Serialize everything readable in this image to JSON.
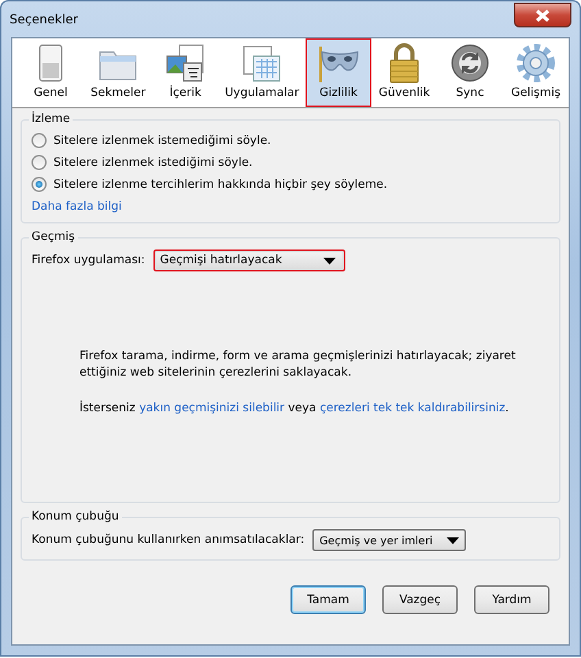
{
  "window": {
    "title": "Seçenekler"
  },
  "tabs": [
    {
      "label": "Genel",
      "selected": false
    },
    {
      "label": "Sekmeler",
      "selected": false
    },
    {
      "label": "İçerik",
      "selected": false
    },
    {
      "label": "Uygulamalar",
      "selected": false
    },
    {
      "label": "Gizlilik",
      "selected": true
    },
    {
      "label": "Güvenlik",
      "selected": false
    },
    {
      "label": "Sync",
      "selected": false
    },
    {
      "label": "Gelişmiş",
      "selected": false
    }
  ],
  "tracking": {
    "title": "İzleme",
    "options": [
      {
        "label": "Sitelere izlenmek istemediğimi söyle.",
        "selected": false
      },
      {
        "label": "Sitelere izlenmek istediğimi söyle.",
        "selected": false
      },
      {
        "label": "Sitelere izlenme tercihlerim hakkında hiçbir şey söyleme.",
        "selected": true
      }
    ],
    "link": "Daha fazla bilgi"
  },
  "history": {
    "title": "Geçmiş",
    "label": "Firefox uygulaması:",
    "dropdown": {
      "value": "Geçmişi hatırlayacak",
      "highlighted": true
    },
    "description": "Firefox tarama, indirme, form ve arama geçmişlerinizi hatırlayacak; ziyaret ettiğiniz web sitelerinin çerezlerini saklayacak.",
    "sentence": [
      {
        "kind": "text",
        "text": "İsterseniz "
      },
      {
        "kind": "link",
        "text": "yakın geçmişinizi silebilir"
      },
      {
        "kind": "text",
        "text": " veya "
      },
      {
        "kind": "link",
        "text": "çerezleri tek tek kaldırabilirsiniz"
      },
      {
        "kind": "text",
        "text": "."
      }
    ]
  },
  "location_bar": {
    "title": "Konum çubuğu",
    "label": "Konum çubuğunu kullanırken anımsatılacaklar:",
    "dropdown": {
      "value": "Geçmiş ve yer imleri",
      "highlighted": false
    }
  },
  "buttons": [
    {
      "label": "Tamam",
      "default": true
    },
    {
      "label": "Vazgeç",
      "default": false
    },
    {
      "label": "Yardım",
      "default": false
    }
  ]
}
